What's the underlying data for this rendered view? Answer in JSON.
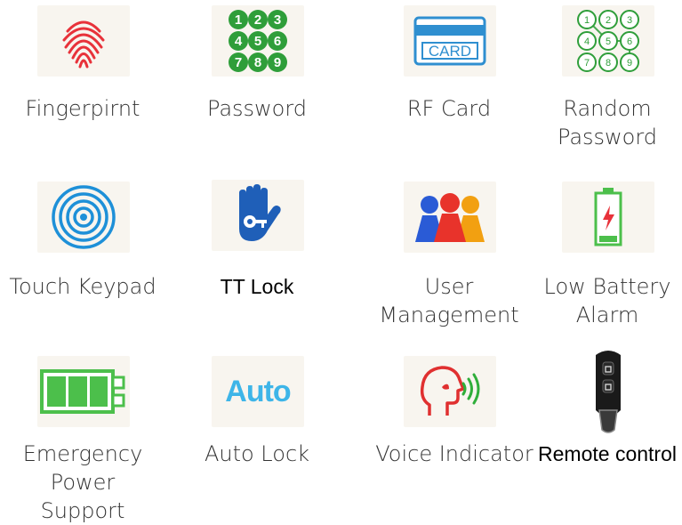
{
  "features": [
    {
      "label": "Fingerpirnt",
      "icon": "fingerprint-icon"
    },
    {
      "label": "Password",
      "icon": "numeric-keypad-icon",
      "digits": [
        "1",
        "2",
        "3",
        "4",
        "5",
        "6",
        "7",
        "8",
        "9"
      ]
    },
    {
      "label": "RF Card",
      "icon": "card-icon",
      "card_text": "CARD"
    },
    {
      "label": "Random Password",
      "label_lines": [
        "Random",
        "Password"
      ],
      "icon": "random-keypad-icon",
      "digits": [
        "1",
        "2",
        "3",
        "4",
        "5",
        "6",
        "7",
        "8",
        "9"
      ]
    },
    {
      "label": "Touch Keypad",
      "icon": "touch-rings-icon"
    },
    {
      "label": "TT Lock",
      "icon": "hand-key-icon"
    },
    {
      "label": "User Management",
      "label_lines": [
        "User",
        "Management"
      ],
      "icon": "users-icon"
    },
    {
      "label": "Low Battery Alarm",
      "label_lines": [
        "Low Battery",
        "Alarm"
      ],
      "icon": "low-battery-icon"
    },
    {
      "label": "Emergency Power Support",
      "label_lines": [
        "Emergency Power",
        "Support"
      ],
      "icon": "battery-full-icon"
    },
    {
      "label": "Auto Lock",
      "icon": "auto-text-icon",
      "icon_text": "Auto"
    },
    {
      "label": "Voice Indicator",
      "icon": "voice-head-icon"
    },
    {
      "label": "Remote control",
      "icon": "remote-key-fob-icon"
    }
  ],
  "colors": {
    "fingerprint": "#e8323a",
    "keypad_green": "#2f9e3a",
    "card_blue": "#2f8fd0",
    "touch_blue": "#1e90d8",
    "hand_blue": "#1f5fb8",
    "user_blue": "#2a5bd6",
    "user_red": "#e8332b",
    "user_orange": "#f2a011",
    "battery_green": "#4cbf4b",
    "auto_blue": "#3eb5e8",
    "voice_red": "#e03030",
    "voice_green": "#2fae3a",
    "remote_black": "#1a1a1a"
  }
}
